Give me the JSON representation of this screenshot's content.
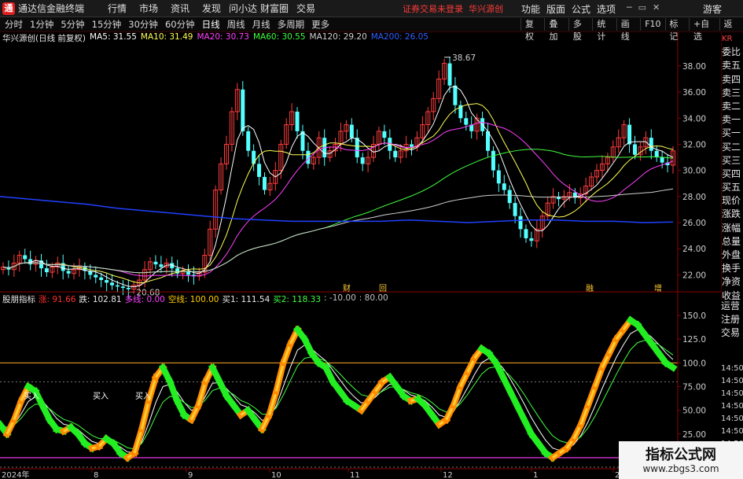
{
  "titlebar": {
    "app_title": "通达信金融终端",
    "menu": [
      "行情",
      "市场",
      "资讯",
      "发现",
      "问小达",
      "财富圈",
      "交易"
    ],
    "login_msg": "证券交易未登录",
    "broker": "华兴源创",
    "right_menu": [
      "功能",
      "版面",
      "公式",
      "选项"
    ],
    "guest": "游客"
  },
  "toolbar": {
    "periods": [
      "分时",
      "1分钟",
      "5分钟",
      "15分钟",
      "30分钟",
      "60分钟",
      "日线",
      "周线",
      "月线",
      "多周期",
      "更多"
    ],
    "active_period": "日线",
    "tools": [
      "复权",
      "叠加",
      "多股",
      "统计",
      "画线",
      "F10",
      "标记",
      "+自选",
      "返回"
    ]
  },
  "main_chart": {
    "stock_title": "华兴源创(日线 前复权)",
    "ma": [
      {
        "label": "MA5: 31.55",
        "color": "#ffffff"
      },
      {
        "label": "MA10: 31.49",
        "color": "#ffff55"
      },
      {
        "label": "MA20: 30.73",
        "color": "#ff40ff"
      },
      {
        "label": "MA60: 30.55",
        "color": "#40ff40"
      },
      {
        "label": "MA120: 29.20",
        "color": "#d0d0d0"
      },
      {
        "label": "MA200: 26.05",
        "color": "#3060ff"
      }
    ],
    "high_label": "38.67",
    "low_label": "20.68",
    "event_marks": [
      "财",
      "回",
      "融",
      "增"
    ],
    "y_ticks": [
      "38.00",
      "36.00",
      "34.00",
      "32.00",
      "30.00",
      "28.00",
      "26.00",
      "24.00",
      "22.00"
    ]
  },
  "indicator": {
    "name": "股朋指标",
    "items": [
      {
        "label": "涨: 91.66",
        "color": "#ff3030"
      },
      {
        "label": "跌: 102.81",
        "color": "#e8e8e8"
      },
      {
        "label": "多线: 0.00",
        "color": "#ff40ff"
      },
      {
        "label": "空线: 100.00",
        "color": "#ffcc00"
      },
      {
        "label": "买1: 111.54",
        "color": "#e8e8e8"
      },
      {
        "label": "买2: 118.33",
        "color": "#40ff40"
      },
      {
        "label": ": -10.00",
        "color": "#c0c0c0"
      },
      {
        "label": ": 80.00",
        "color": "#c0c0c0"
      }
    ],
    "buy_labels": [
      "买入",
      "买入",
      "买入"
    ],
    "y_ticks": [
      "150.0",
      "125.0",
      "100.0",
      "75.00",
      "50.00",
      "25.00",
      "0.00"
    ]
  },
  "x_axis": [
    "2024年",
    "8",
    "9",
    "10",
    "11",
    "12",
    "1",
    "2"
  ],
  "side_panel": {
    "code": "KR",
    "rows": [
      "委比",
      "卖五",
      "卖四",
      "卖三",
      "卖二",
      "卖一",
      "买一",
      "买二",
      "买三",
      "买四",
      "买五",
      "现价",
      "涨跌",
      "涨幅",
      "总量",
      "外盘",
      "换手",
      "净资",
      "收益"
    ],
    "rows2": [
      "运营",
      "注册",
      "交易"
    ],
    "times": [
      "14:50",
      "14:50",
      "14:50",
      "14:50",
      "14:50",
      "14:50",
      "14:50",
      "14:50"
    ]
  },
  "watermark": {
    "title": "指标公式网",
    "url": "www.zbgs3.com"
  },
  "chart_data": [
    {
      "type": "candlestick",
      "title": "华兴源创(日线 前复权)",
      "ylim": [
        21,
        39.5
      ],
      "series": [
        {
          "name": "close",
          "values": [
            22.6,
            22.4,
            22.9,
            23.5,
            23.2,
            22.8,
            23.1,
            22.5,
            22.2,
            22.6,
            22.9,
            22.3,
            22.1,
            22.4,
            22.6,
            22.3,
            22.0,
            21.8,
            21.6,
            21.4,
            21.2,
            21.1,
            21.0,
            20.9,
            21.2,
            21.6,
            22.4,
            23.0,
            22.8,
            22.6,
            22.9,
            22.5,
            22.1,
            22.3,
            22.0,
            21.9,
            22.2,
            23.5,
            25.5,
            28.5,
            30.5,
            32.0,
            34.5,
            36.2,
            33.0,
            31.5,
            30.5,
            29.5,
            28.5,
            29.0,
            30.0,
            32.0,
            33.5,
            34.5,
            33.0,
            31.5,
            30.5,
            31.0,
            32.5,
            31.0,
            31.5,
            32.0,
            33.0,
            33.5,
            32.5,
            31.0,
            30.5,
            31.0,
            32.0,
            33.0,
            32.5,
            31.5,
            31.0,
            31.5,
            32.0,
            31.8,
            32.5,
            33.5,
            34.5,
            35.5,
            37.0,
            38.2,
            36.5,
            35.0,
            34.0,
            33.5,
            33.0,
            34.0,
            33.0,
            31.5,
            30.0,
            29.0,
            28.5,
            27.5,
            26.5,
            25.5,
            24.8,
            24.6,
            25.5,
            26.5,
            27.5,
            28.0,
            27.8,
            28.0,
            28.3,
            27.9,
            28.2,
            28.8,
            29.5,
            30.0,
            30.5,
            31.0,
            31.8,
            32.5,
            33.5,
            32.0,
            31.2,
            31.8,
            32.5,
            31.5,
            31.0,
            30.6,
            30.4,
            31.5
          ]
        },
        {
          "name": "MA200",
          "values": [
            28.0,
            27.8,
            27.6,
            27.4,
            27.1,
            26.9,
            26.7,
            26.5,
            26.3,
            26.2,
            26.1,
            26.1,
            26.1,
            26.1,
            26.2,
            26.1,
            26.0,
            26.1,
            26.2,
            26.2,
            26.1,
            26.1,
            26.0,
            26.05
          ]
        }
      ]
    },
    {
      "type": "line",
      "title": "股朋指标",
      "ylim": [
        -10,
        160
      ],
      "series": [
        {
          "name": "涨",
          "values": [
            35,
            25,
            40,
            60,
            75,
            70,
            55,
            40,
            30,
            28,
            32,
            25,
            15,
            10,
            12,
            20,
            15,
            5,
            0,
            5,
            30,
            60,
            85,
            95,
            80,
            60,
            45,
            40,
            55,
            80,
            95,
            80,
            65,
            55,
            45,
            50,
            40,
            30,
            45,
            70,
            100,
            120,
            135,
            125,
            110,
            100,
            95,
            80,
            70,
            60,
            55,
            50,
            60,
            70,
            80,
            85,
            75,
            65,
            60,
            62,
            55,
            45,
            35,
            40,
            55,
            75,
            90,
            105,
            115,
            110,
            100,
            85,
            70,
            55,
            40,
            25,
            15,
            5,
            0,
            5,
            10,
            20,
            35,
            55,
            75,
            95,
            110,
            125,
            135,
            145,
            140,
            130,
            120,
            110,
            100,
            95
          ]
        },
        {
          "name": "多线",
          "values": [
            0,
            0,
            0,
            0,
            0,
            0,
            0,
            0,
            0,
            0,
            0,
            0,
            0,
            0,
            0,
            0,
            0,
            0,
            0,
            0,
            0,
            0,
            0,
            0,
            0,
            0,
            0,
            0,
            0,
            0,
            0,
            0,
            0,
            0,
            0,
            0,
            0,
            0,
            0,
            0,
            0,
            0,
            0,
            0,
            0,
            0,
            0,
            0,
            0,
            0,
            0,
            0,
            0,
            0,
            0,
            0,
            0,
            0,
            0,
            0,
            0,
            0,
            0,
            0,
            0,
            0,
            0,
            0,
            0,
            0,
            0,
            0,
            0,
            0,
            0,
            0,
            0,
            0,
            0,
            0,
            0,
            0,
            0,
            0,
            0,
            0,
            0,
            0,
            0,
            0,
            0,
            0,
            0,
            0,
            0,
            0
          ]
        },
        {
          "name": "空线",
          "values": [
            100,
            100,
            100,
            100,
            100,
            100,
            100,
            100,
            100,
            100,
            100,
            100,
            100,
            100,
            100,
            100,
            100,
            100,
            100,
            100,
            100,
            100,
            100,
            100,
            100,
            100,
            100,
            100,
            100,
            100,
            100,
            100,
            100,
            100,
            100,
            100,
            100,
            100,
            100,
            100,
            100,
            100,
            100,
            100,
            100,
            100,
            100,
            100,
            100,
            100,
            100,
            100,
            100,
            100,
            100,
            100,
            100,
            100,
            100,
            100,
            100,
            100,
            100,
            100,
            100,
            100,
            100,
            100,
            100,
            100,
            100,
            100,
            100,
            100,
            100,
            100,
            100,
            100,
            100,
            100,
            100,
            100,
            100,
            100,
            100,
            100,
            100,
            100,
            100,
            100,
            100,
            100,
            100,
            100,
            100,
            100
          ]
        }
      ]
    }
  ]
}
